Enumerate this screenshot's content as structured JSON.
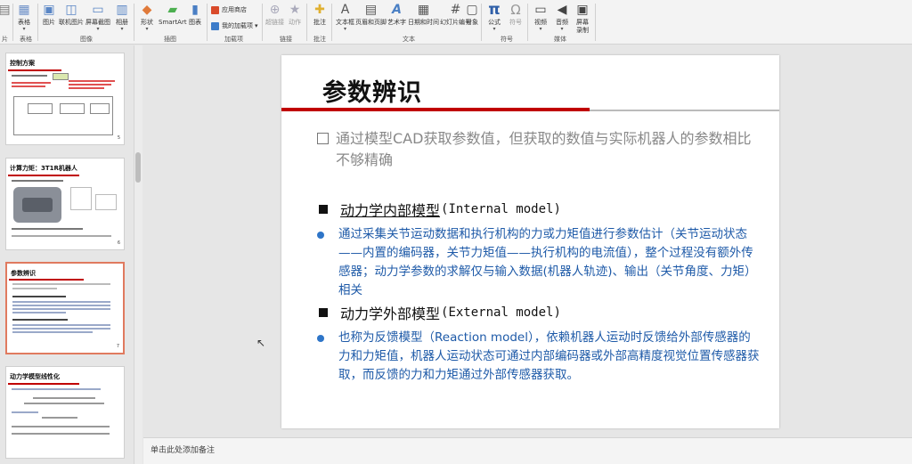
{
  "ribbon": {
    "buttons": [
      {
        "id": "partial-left",
        "label": "",
        "x": 0
      },
      {
        "id": "table",
        "label": "表格",
        "icon": "table-icon",
        "color": "#6b8fc7"
      },
      {
        "id": "picture",
        "label": "图片",
        "icon": "picture-icon",
        "color": "#5a86c5"
      },
      {
        "id": "online-picture",
        "label": "联机图片",
        "icon": "online-picture-icon",
        "color": "#5a86c5"
      },
      {
        "id": "screenshot",
        "label": "屏幕截图",
        "icon": "screenshot-icon",
        "color": "#5a86c5"
      },
      {
        "id": "album",
        "label": "相册",
        "icon": "album-icon",
        "color": "#5a86c5"
      },
      {
        "id": "shapes",
        "label": "形状",
        "icon": "shapes-icon",
        "color": "#e07a3a"
      },
      {
        "id": "smartart",
        "label": "SmartArt",
        "icon": "smartart-icon",
        "color": "#4caf50"
      },
      {
        "id": "chart",
        "label": "图表",
        "icon": "chart-icon",
        "color": "#4a7fc4"
      },
      {
        "id": "hyperlink",
        "label": "超链接",
        "icon": "hyperlink-icon",
        "color": "#9aa"
      },
      {
        "id": "action",
        "label": "动作",
        "icon": "action-icon",
        "color": "#9aa"
      },
      {
        "id": "comment",
        "label": "批注",
        "icon": "comment-icon",
        "color": "#e0b030"
      },
      {
        "id": "textbox",
        "label": "文本框",
        "icon": "textbox-icon",
        "color": "#666"
      },
      {
        "id": "header-footer",
        "label": "页眉和页脚",
        "icon": "header-footer-icon",
        "color": "#666"
      },
      {
        "id": "wordart",
        "label": "艺术字",
        "icon": "wordart-icon",
        "color": "#4a7fc4"
      },
      {
        "id": "datetime",
        "label": "日期和时间",
        "icon": "datetime-icon",
        "color": "#666"
      },
      {
        "id": "slide-number",
        "label": "幻灯片编号",
        "icon": "slide-number-icon",
        "color": "#666"
      },
      {
        "id": "object",
        "label": "对象",
        "icon": "object-icon",
        "color": "#666"
      },
      {
        "id": "equation",
        "label": "公式",
        "icon": "equation-icon",
        "color": "#2f5fa8"
      },
      {
        "id": "symbol",
        "label": "符号",
        "icon": "symbol-icon",
        "color": "#999"
      },
      {
        "id": "video",
        "label": "视频",
        "icon": "video-icon",
        "color": "#555"
      },
      {
        "id": "audio",
        "label": "音频",
        "icon": "audio-icon",
        "color": "#555"
      },
      {
        "id": "screen-recording",
        "label": "屏幕录制",
        "icon": "screen-recording-icon",
        "color": "#555"
      }
    ],
    "addins": {
      "store": "应用商店",
      "my_addins": "我的加载项"
    },
    "groups": {
      "left_partial": "片",
      "tables": "表格",
      "images": "图像",
      "illustrations": "插图",
      "addins": "加载项",
      "links": "链接",
      "comments": "批注",
      "text": "文本",
      "symbols": "符号",
      "media": "媒体"
    },
    "equation_glyph": "π",
    "symbol_glyph": "Ω"
  },
  "thumbnails": [
    {
      "title": "控制方案",
      "num": "5"
    },
    {
      "title": "计算力矩：3T1R机器人",
      "num": "6"
    },
    {
      "title": "参数辨识",
      "num": "7",
      "selected": true
    },
    {
      "title": "动力学模型线性化",
      "num": "8"
    }
  ],
  "slide": {
    "title": "参数辨识",
    "intro": "通过模型CAD获取参数值，但获取的数值与实际机器人的参数相比不够精确",
    "section1": {
      "label": "动力学内部模型",
      "en": "(Internal model)"
    },
    "para1": "通过采集关节运动数据和执行机构的力或力矩值进行参数估计（关节运动状态——内置的编码器，关节力矩值——执行机构的电流值），整个过程没有额外传感器；动力学参数的求解仅与输入数据(机器人轨迹)、输出（关节角度、力矩）相关",
    "section2": {
      "label": "动力学外部模型",
      "en": "(External model)"
    },
    "para2": "也称为反馈模型（Reaction model），依赖机器人运动时反馈给外部传感器的力和力矩值，机器人运动状态可通过内部编码器或外部高精度视觉位置传感器获取，而反馈的力和力矩通过外部传感器获取。"
  },
  "notes": {
    "placeholder": "单击此处添加备注"
  },
  "colors": {
    "accent_red": "#c00000",
    "body_blue": "#1e5aa8",
    "intro_grey": "#888888"
  }
}
